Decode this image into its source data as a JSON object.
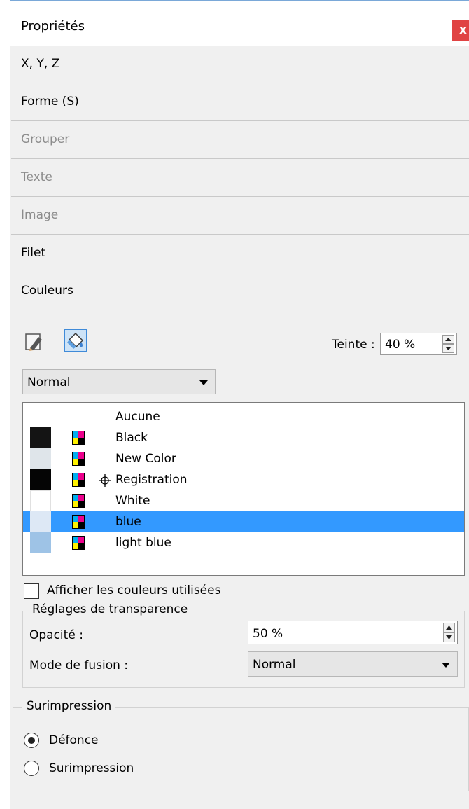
{
  "panel": {
    "title": "Propriétés",
    "close_label": "x"
  },
  "sections": [
    {
      "label": "X, Y, Z",
      "enabled": true
    },
    {
      "label": "Forme (S)",
      "enabled": true
    },
    {
      "label": "Grouper",
      "enabled": false
    },
    {
      "label": "Texte",
      "enabled": false
    },
    {
      "label": "Image",
      "enabled": false
    },
    {
      "label": "Filet",
      "enabled": true
    },
    {
      "label": "Couleurs",
      "enabled": true
    }
  ],
  "colors": {
    "toolbar": {
      "pencil_icon": "pencil-icon",
      "bucket_icon": "paint-bucket-icon",
      "active": "bucket"
    },
    "teinte_label": "Teinte :",
    "teinte_value": "40 %",
    "blend_mode": "Normal",
    "list": [
      {
        "name": "Aucune",
        "swatch": null,
        "model_icon": false,
        "selected": false
      },
      {
        "name": "Black",
        "swatch": "#141414",
        "model_icon": true,
        "selected": false
      },
      {
        "name": "New Color",
        "swatch": "#dfe5ea",
        "model_icon": true,
        "selected": false
      },
      {
        "name": "Registration",
        "swatch": "#050505",
        "model_icon": true,
        "registration": true,
        "selected": false
      },
      {
        "name": "White",
        "swatch": "#ffffff",
        "model_icon": true,
        "selected": false
      },
      {
        "name": "blue",
        "swatch": "#dde8f5",
        "model_icon": true,
        "selected": true
      },
      {
        "name": "light blue",
        "swatch": "#9ec3e6",
        "model_icon": true,
        "selected": false
      }
    ],
    "show_used_label": "Afficher les couleurs utilisées",
    "show_used_checked": false
  },
  "transparency": {
    "legend": "Réglages de transparence",
    "opacity_label": "Opacité :",
    "opacity_value": "50 %",
    "blend_label": "Mode de fusion :",
    "blend_value": "Normal"
  },
  "overprint": {
    "legend": "Surimpression",
    "options": [
      {
        "label": "Défonce",
        "checked": true
      },
      {
        "label": "Surimpression",
        "checked": false
      }
    ]
  },
  "accent_colors": {
    "selection": "#3399ff",
    "close": "#e04343"
  }
}
